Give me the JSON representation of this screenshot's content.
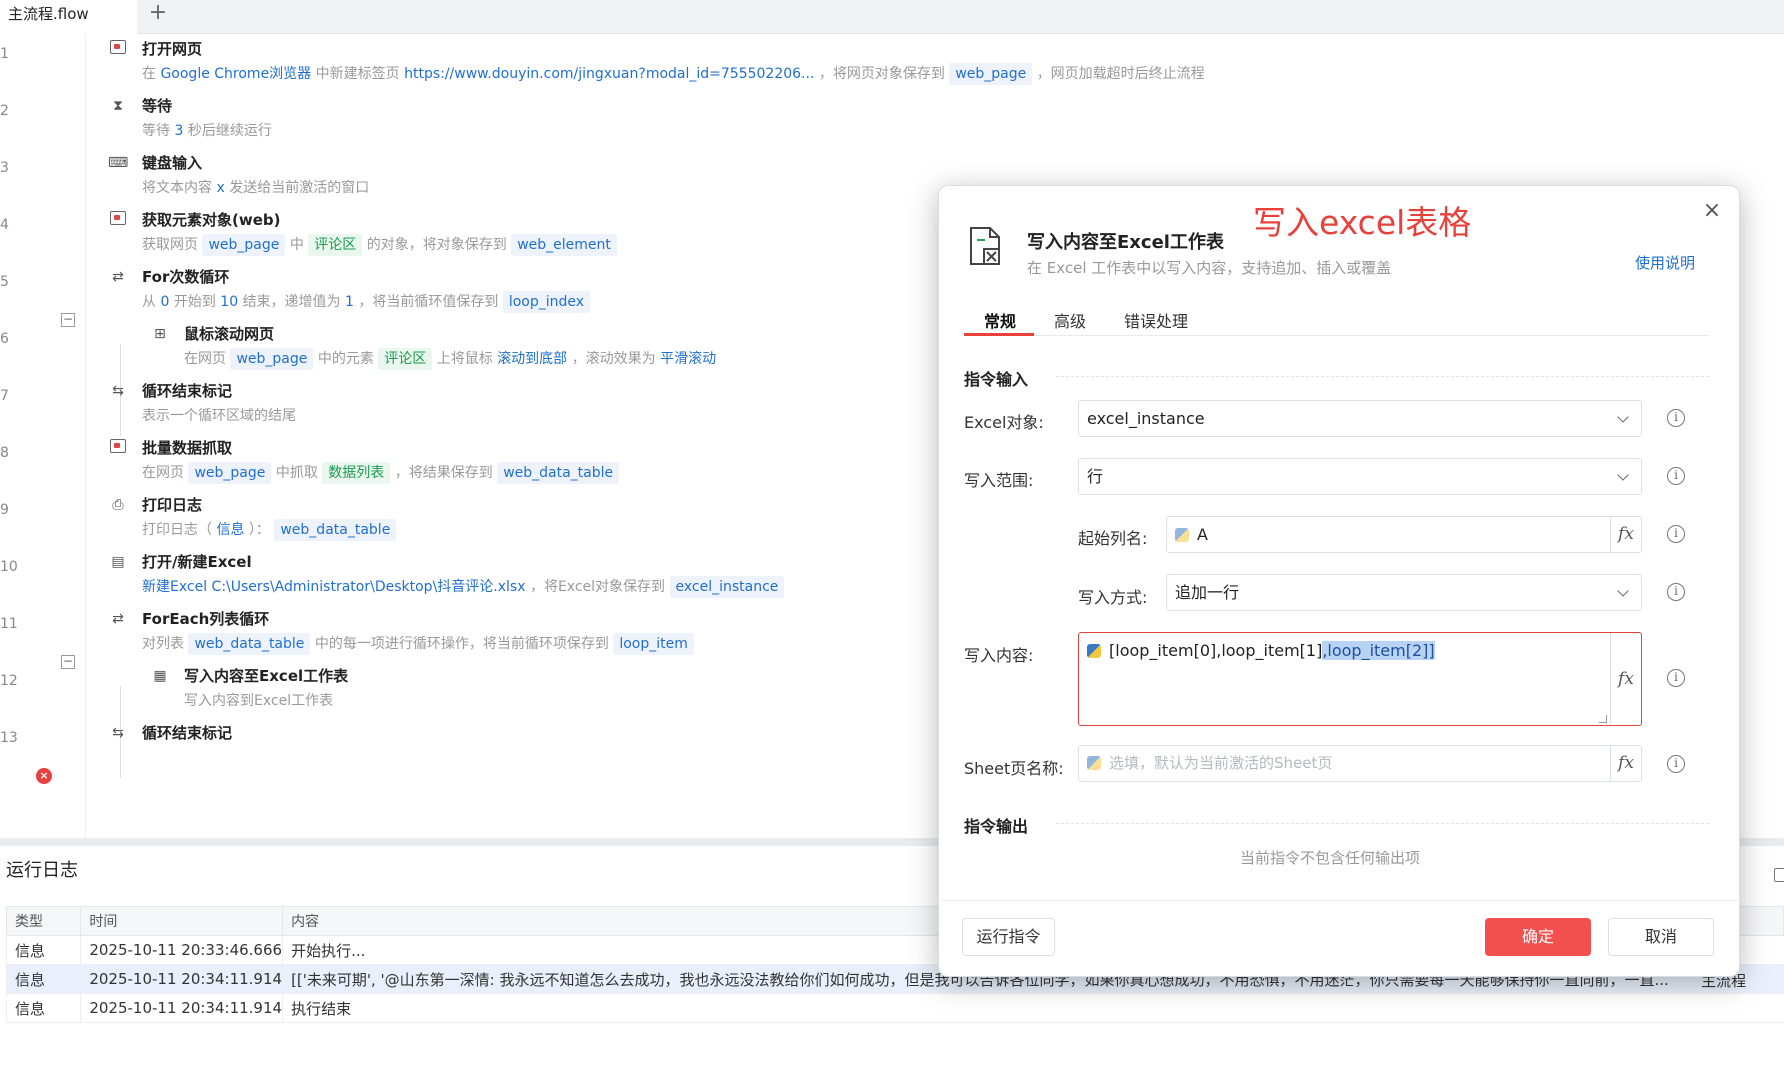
{
  "tabs": {
    "active_label": "主流程.flow",
    "add_label": "+"
  },
  "flow": {
    "line_numbers": [
      "1",
      "2",
      "3",
      "4",
      "5",
      "6",
      "7",
      "8",
      "9",
      "10",
      "11",
      "12",
      "13"
    ],
    "steps": {
      "open_web": {
        "title": "打开网页",
        "d1": "在",
        "browser": "Google Chrome浏览器",
        "d2": "中新建标签页",
        "url": "https://www.douyin.com/jingxuan?modal_id=755502206...",
        "d3": "，将网页对象保存到",
        "var": "web_page",
        "d4": "，网页加载超时后终止流程"
      },
      "wait": {
        "title": "等待",
        "d1": "等待",
        "num": "3",
        "d2": "秒后继续运行"
      },
      "keyboard": {
        "title": "键盘输入",
        "d1": "将文本内容",
        "var": "x",
        "d2": "发送给当前激活的窗口"
      },
      "get_element": {
        "title": "获取元素对象(web)",
        "d1": "获取网页",
        "var1": "web_page",
        "d2": "中",
        "elem": "评论区",
        "d3": "的对象，将对象保存到",
        "var2": "web_element"
      },
      "for_loop": {
        "title": "For次数循环",
        "d1": "从",
        "start": "0",
        "d2": "开始到",
        "end": "10",
        "d3": "结束，递增值为",
        "step": "1",
        "d4": "，将当前循环值保存到",
        "var": "loop_index"
      },
      "scroll": {
        "title": "鼠标滚动网页",
        "d1": "在网页",
        "var": "web_page",
        "d2": "中的元素",
        "elem": "评论区",
        "d3": "上将鼠标",
        "action": "滚动到底部",
        "d4": "，滚动效果为",
        "effect": "平滑滚动"
      },
      "loop_end_1": {
        "title": "循环结束标记",
        "desc": "表示一个循环区域的结尾"
      },
      "batch": {
        "title": "批量数据抓取",
        "d1": "在网页",
        "var1": "web_page",
        "d2": "中抓取",
        "elem": "数据列表",
        "d3": "，将结果保存到",
        "var2": "web_data_table"
      },
      "print_log": {
        "title": "打印日志",
        "d1": "打印日志（",
        "level": "信息",
        "d2": "）：",
        "var": "web_data_table"
      },
      "open_excel": {
        "title": "打开/新建Excel",
        "action": "新建Excel",
        "path": "C:\\Users\\Administrator\\Desktop\\抖音评论.xlsx",
        "d1": "，将Excel对象保存到",
        "var": "excel_instance"
      },
      "foreach": {
        "title": "ForEach列表循环",
        "d1": "对列表",
        "var1": "web_data_table",
        "d2": "中的每一项进行循环操作，将当前循环项保存到",
        "var2": "loop_item"
      },
      "write_excel": {
        "title": "写入内容至Excel工作表",
        "desc": "写入内容到Excel工作表"
      },
      "loop_end_2": {
        "title": "循环结束标记"
      }
    },
    "collapse_symbol": "−",
    "error_symbol": "×"
  },
  "log": {
    "title": "运行日志",
    "columns": [
      "类型",
      "时间",
      "内容"
    ],
    "rows": [
      {
        "type": "信息",
        "time": "2025-10-11 20:33:46.666",
        "content": "开始执行..."
      },
      {
        "type": "信息",
        "time": "2025-10-11 20:34:11.914",
        "content": "[['未来可期', '@山东第一深情: 我永远不知道怎么去成功，我也永远没法教给你们如何成功，但是我可以告诉各位同学，如果你真心想成功，不用恐惧，不用迷茫，你只需要每一天能够保持你一直向前，一直...",
        "source": "主流程"
      },
      {
        "type": "信息",
        "time": "2025-10-11 20:34:11.914",
        "content": "执行结束"
      }
    ]
  },
  "modal": {
    "title": "写入内容至Excel工作表",
    "subtitle": "在 Excel 工作表中以写入内容，支持追加、插入或覆盖",
    "annotation": "写入excel表格",
    "help_link": "使用说明",
    "close_symbol": "×",
    "tabs": [
      "常规",
      "高级",
      "错误处理"
    ],
    "section_input": "指令输入",
    "section_output": "指令输出",
    "fields": {
      "excel_obj": {
        "label": "Excel对象:",
        "value": "excel_instance"
      },
      "range": {
        "label": "写入范围:",
        "value": "行"
      },
      "start_col": {
        "label": "起始列名:",
        "value": "A"
      },
      "write_mode": {
        "label": "写入方式:",
        "value": "追加一行"
      },
      "content": {
        "label": "写入内容:",
        "value_plain": "[loop_item[0],loop_item[1]",
        "value_selected": ",loop_item[2]]"
      },
      "sheet": {
        "label": "Sheet页名称:",
        "placeholder": "选填，默认为当前激活的Sheet页"
      }
    },
    "fx_label": "fx",
    "info_label": "i",
    "no_output": "当前指令不包含任何输出项",
    "buttons": {
      "run": "运行指令",
      "ok": "确定",
      "cancel": "取消"
    }
  }
}
